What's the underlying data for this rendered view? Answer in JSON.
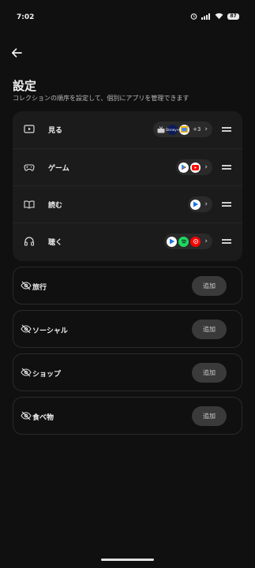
{
  "status": {
    "time": "7:02",
    "battery": "87"
  },
  "header": {
    "title": "設定",
    "subtitle": "コレクションの順序を設定して、個別にアプリを管理できます"
  },
  "categories": [
    {
      "label": "見る",
      "icon": "play-screen-icon",
      "more": "+3"
    },
    {
      "label": "ゲーム",
      "icon": "gamepad-icon"
    },
    {
      "label": "読む",
      "icon": "book-icon"
    },
    {
      "label": "聴く",
      "icon": "headphones-icon"
    }
  ],
  "hidden": [
    {
      "label": "旅行",
      "button": "追加"
    },
    {
      "label": "ソーシャル",
      "button": "追加"
    },
    {
      "label": "ショップ",
      "button": "追加"
    },
    {
      "label": "食べ物",
      "button": "追加"
    }
  ],
  "app_badges": {
    "disney": "Disney+"
  },
  "colors": {
    "background": "#101010",
    "card": "#1b1b1b",
    "chip": "#2a2a2a",
    "button": "#3a3a3a"
  }
}
